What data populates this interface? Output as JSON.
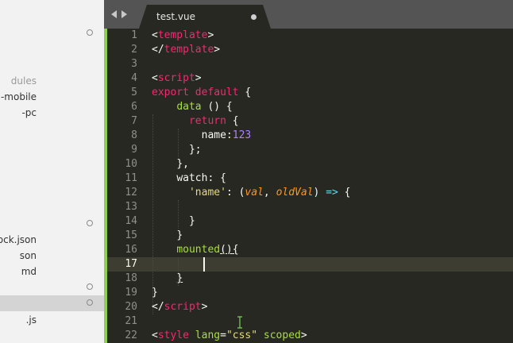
{
  "sidebar": {
    "items": [
      {
        "label": "",
        "has_circle": true
      },
      {
        "label": "dules",
        "muted": true
      },
      {
        "label": "-mobile"
      },
      {
        "label": "-pc"
      },
      {
        "label": "",
        "has_circle": true
      },
      {
        "label": "ock.json"
      },
      {
        "label": "son"
      },
      {
        "label": "md"
      },
      {
        "label": "",
        "has_circle": true
      },
      {
        "label": "",
        "has_circle": true,
        "selected": true
      },
      {
        "label": ".js"
      }
    ]
  },
  "tab": {
    "title": "test.vue",
    "modified": true
  },
  "editor": {
    "active_line": 17,
    "line_numbers": [
      "1",
      "2",
      "3",
      "4",
      "5",
      "6",
      "7",
      "8",
      "9",
      "10",
      "11",
      "12",
      "13",
      "14",
      "15",
      "16",
      "17",
      "18",
      "19",
      "20",
      "21",
      "22"
    ],
    "code": {
      "l1_open": "<",
      "l1_tag": "template",
      "l1_close": ">",
      "l2_open": "</",
      "l2_tag": "template",
      "l2_close": ">",
      "l4_open": "<",
      "l4_tag": "script",
      "l4_close": ">",
      "l5_export": "export",
      "l5_default": "default",
      "l5_rest": " {",
      "l6_fn": "data",
      "l6_rest": " () {",
      "l7_return": "return",
      "l7_rest": " {",
      "l8_key": "name:",
      "l8_num": "123",
      "l9": "};",
      "l10": "},",
      "l11": "watch: {",
      "l12_str": "'name'",
      "l12_a": ": (",
      "l12_p1": "val",
      "l12_b": ", ",
      "l12_p2": "oldVal",
      "l12_c": ") ",
      "l12_arrow": "=>",
      "l12_d": " {",
      "l14": "}",
      "l15": "}",
      "l16_fn": "mounted",
      "l16_paren": "()",
      "l16_brace": "{",
      "l18": "}",
      "l19": "}",
      "l20_open": "</",
      "l20_tag": "script",
      "l20_close": ">",
      "l22_open": "<",
      "l22_tag": "style",
      "l22_attr": "lang",
      "l22_eq": "=",
      "l22_str": "\"css\"",
      "l22_scoped": "scoped",
      "l22_close": ">"
    }
  },
  "colors": {
    "editor_bg": "#272822",
    "tab_bar": "#545454",
    "active_tab": "#272822",
    "sidebar_bg": "#f2f2f2",
    "modified_gutter": "#8fd14f",
    "keyword": "#f92672",
    "function": "#a6e22e",
    "string": "#e6db74",
    "number": "#ae81ff",
    "parameter": "#fd971f",
    "arrow": "#66d9ef"
  }
}
